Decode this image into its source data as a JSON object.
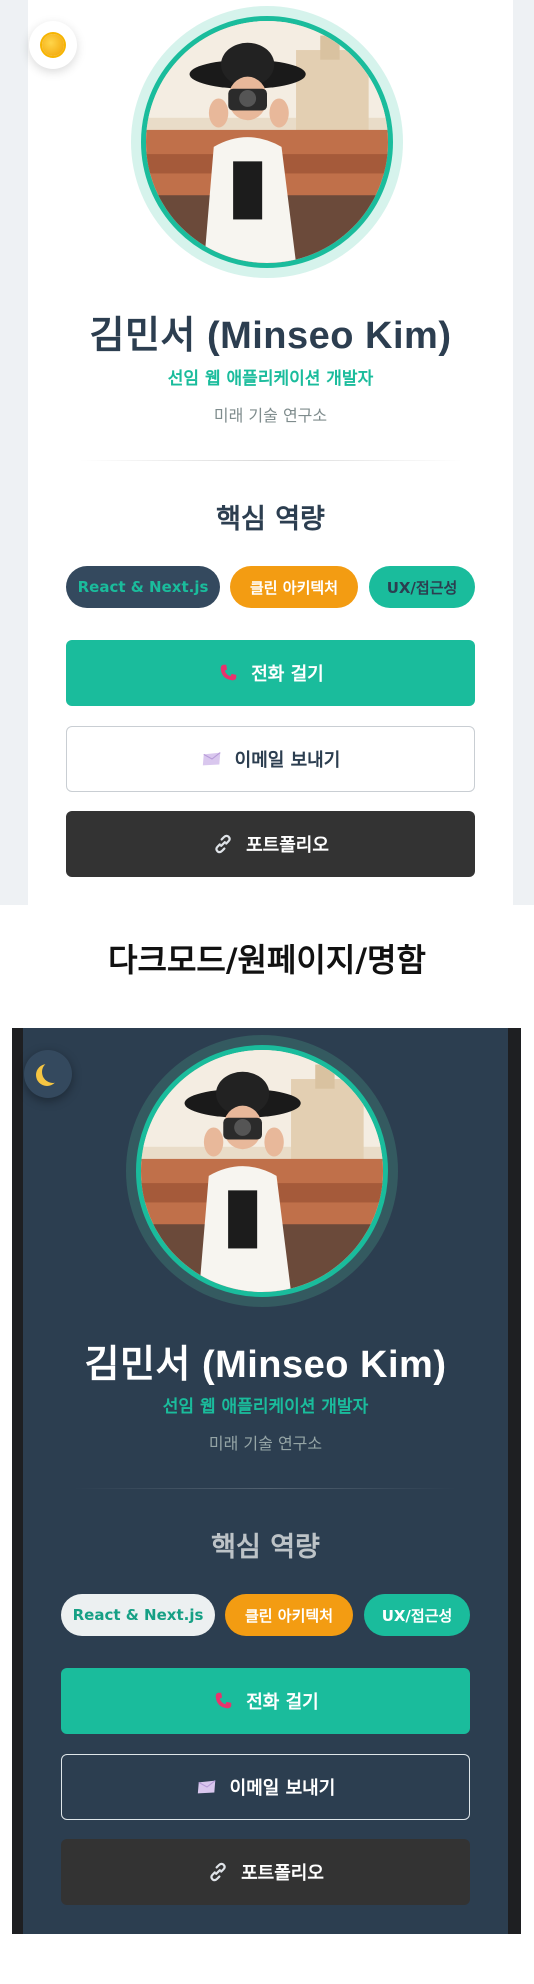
{
  "caption": "다크모드/원페이지/명함",
  "theme": {
    "accent": "#1abc9c",
    "dark": "#2c3e50",
    "orange": "#f39c12"
  },
  "light_card": {
    "theme_icon": "sun-icon",
    "name": "김민서 (Minseo Kim)",
    "role": "선임 웹 애플리케이션 개발자",
    "org": "미래 기술 연구소",
    "skills_title": "핵심 역량",
    "skills": [
      "React & Next.js",
      "클린 아키텍처",
      "UX/접근성"
    ],
    "buttons": {
      "call": "전화 걸기",
      "email": "이메일 보내기",
      "portfolio": "포트폴리오"
    }
  },
  "dark_card": {
    "theme_icon": "moon-icon",
    "name": "김민서 (Minseo Kim)",
    "role": "선임 웹 애플리케이션 개발자",
    "org": "미래 기술 연구소",
    "skills_title": "핵심 역량",
    "skills": [
      "React & Next.js",
      "클린 아키텍처",
      "UX/접근성"
    ],
    "buttons": {
      "call": "전화 걸기",
      "email": "이메일 보내기",
      "portfolio": "포트폴리오"
    }
  }
}
